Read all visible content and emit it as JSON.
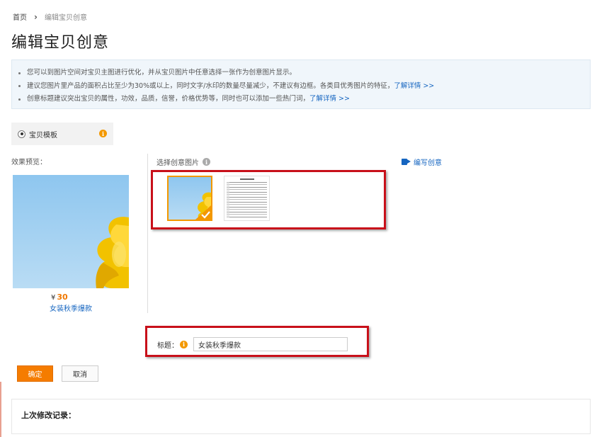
{
  "breadcrumb": {
    "home": "首页",
    "separator": "›",
    "current": "编辑宝贝创意"
  },
  "page": {
    "title": "编辑宝贝创意"
  },
  "notice": {
    "items": [
      {
        "text": "您可以到图片空间对宝贝主图进行优化，并从宝贝图片中任意选择一张作为创意图片显示。",
        "link": ""
      },
      {
        "text": "建议您图片里产品的面积占比至少为30%或以上，同时文字/水印的数量尽量减少，不建议有边框。各类目优秀图片的特征，",
        "link": "了解详情 >>"
      },
      {
        "text": "创意标题建议突出宝贝的属性，功效，品质，信誉，价格优势等，同时也可以添加一些热门词，",
        "link": "了解详情 >>"
      }
    ]
  },
  "template": {
    "label": "宝贝模板",
    "selected": true,
    "info_icon": "info-icon"
  },
  "preview": {
    "label": "效果预览：",
    "price_symbol": "¥",
    "price": "30",
    "product_name": "女装秋季爆款"
  },
  "picker": {
    "label": "选择创意图片",
    "write_link": "编写创意",
    "selected_index": 0
  },
  "title_field": {
    "label": "标题：",
    "value": "女装秋季爆款"
  },
  "buttons": {
    "confirm": "确定",
    "cancel": "取消"
  },
  "history": {
    "label": "上次修改记录："
  },
  "colors": {
    "accent": "#f57c00",
    "link": "#1565c0",
    "annotation": "#c8101a",
    "notice_bg": "#f0f6fb"
  }
}
